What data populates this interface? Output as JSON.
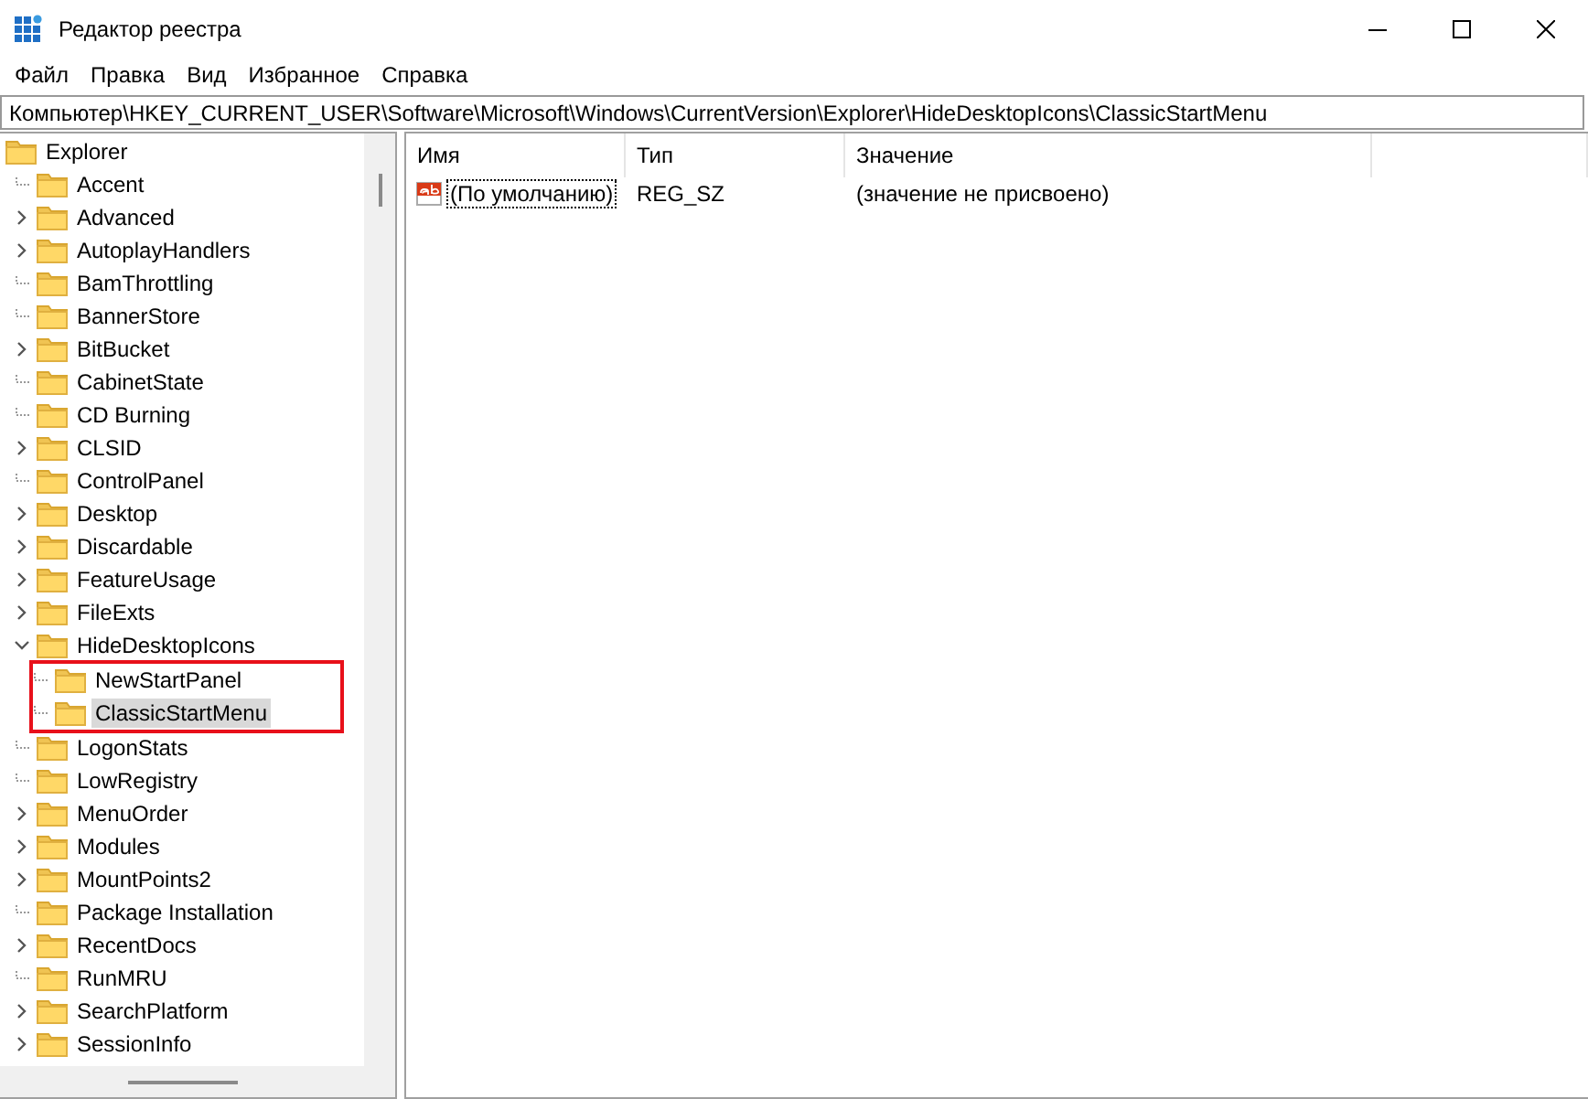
{
  "window": {
    "title": "Редактор реестра"
  },
  "menu": [
    "Файл",
    "Правка",
    "Вид",
    "Избранное",
    "Справка"
  ],
  "address": {
    "value": "Компьютер\\HKEY_CURRENT_USER\\Software\\Microsoft\\Windows\\CurrentVersion\\Explorer\\HideDesktopIcons\\ClassicStartMenu"
  },
  "tree": {
    "label": "Explorer",
    "children": [
      {
        "label": "Accent",
        "has_children": false,
        "selected": false
      },
      {
        "label": "Advanced",
        "has_children": true,
        "expanded": false,
        "selected": false
      },
      {
        "label": "AutoplayHandlers",
        "has_children": true,
        "expanded": false,
        "selected": false
      },
      {
        "label": "BamThrottling",
        "has_children": false,
        "selected": false
      },
      {
        "label": "BannerStore",
        "has_children": false,
        "selected": false
      },
      {
        "label": "BitBucket",
        "has_children": true,
        "expanded": false,
        "selected": false
      },
      {
        "label": "CabinetState",
        "has_children": false,
        "selected": false
      },
      {
        "label": "CD Burning",
        "has_children": false,
        "selected": false
      },
      {
        "label": "CLSID",
        "has_children": true,
        "expanded": false,
        "selected": false
      },
      {
        "label": "ControlPanel",
        "has_children": false,
        "selected": false
      },
      {
        "label": "Desktop",
        "has_children": true,
        "expanded": false,
        "selected": false
      },
      {
        "label": "Discardable",
        "has_children": true,
        "expanded": false,
        "selected": false
      },
      {
        "label": "FeatureUsage",
        "has_children": true,
        "expanded": false,
        "selected": false
      },
      {
        "label": "FileExts",
        "has_children": true,
        "expanded": false,
        "selected": false
      },
      {
        "label": "HideDesktopIcons",
        "has_children": true,
        "expanded": true,
        "selected": false,
        "highlighted_children": true,
        "children": [
          {
            "label": "NewStartPanel",
            "has_children": false,
            "selected": false
          },
          {
            "label": "ClassicStartMenu",
            "has_children": false,
            "selected": true
          }
        ]
      },
      {
        "label": "LogonStats",
        "has_children": false,
        "selected": false
      },
      {
        "label": "LowRegistry",
        "has_children": false,
        "selected": false
      },
      {
        "label": "MenuOrder",
        "has_children": true,
        "expanded": false,
        "selected": false
      },
      {
        "label": "Modules",
        "has_children": true,
        "expanded": false,
        "selected": false
      },
      {
        "label": "MountPoints2",
        "has_children": true,
        "expanded": false,
        "selected": false
      },
      {
        "label": "Package Installation",
        "has_children": false,
        "selected": false
      },
      {
        "label": "RecentDocs",
        "has_children": true,
        "expanded": false,
        "selected": false
      },
      {
        "label": "RunMRU",
        "has_children": false,
        "selected": false
      },
      {
        "label": "SearchPlatform",
        "has_children": true,
        "expanded": false,
        "selected": false
      },
      {
        "label": "SessionInfo",
        "has_children": true,
        "expanded": false,
        "selected": false
      }
    ]
  },
  "table": {
    "columns": [
      "Имя",
      "Тип",
      "Значение"
    ],
    "rows": [
      {
        "kind": "string",
        "cells": [
          "(По умолчанию)",
          "REG_SZ",
          "(значение не присвоено)"
        ],
        "focused": true
      }
    ]
  }
}
